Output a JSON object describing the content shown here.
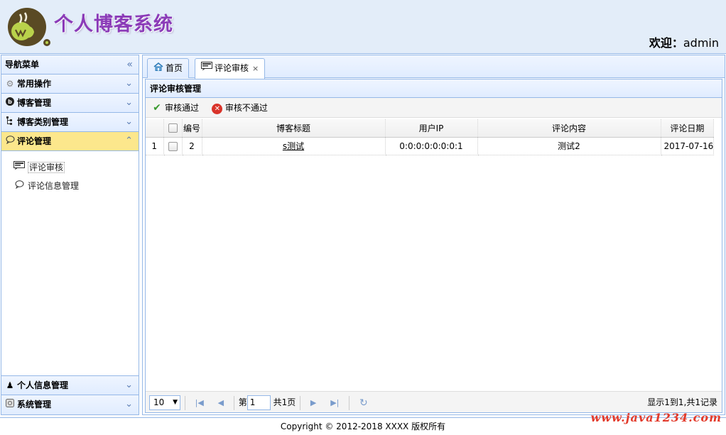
{
  "header": {
    "site_title": "个人博客系统",
    "welcome_label": "欢迎：",
    "username": "admin"
  },
  "sidebar": {
    "title": "导航菜单",
    "sections": [
      {
        "label": "常用操作",
        "icon": "gear-icon"
      },
      {
        "label": "博客管理",
        "icon": "blog-icon"
      },
      {
        "label": "博客类别管理",
        "icon": "tree-icon"
      },
      {
        "label": "评论管理",
        "icon": "comment-icon"
      },
      {
        "label": "个人信息管理",
        "icon": "user-icon"
      },
      {
        "label": "系统管理",
        "icon": "system-icon"
      }
    ],
    "subitems": [
      {
        "label": "评论审核",
        "icon": "review-icon"
      },
      {
        "label": "评论信息管理",
        "icon": "comment-icon"
      }
    ]
  },
  "tabs": [
    {
      "label": "首页",
      "icon": "home-icon"
    },
    {
      "label": "评论审核",
      "icon": "review-icon"
    }
  ],
  "panel": {
    "title": "评论审核管理",
    "toolbar": {
      "approve_label": "审核通过",
      "reject_label": "审核不通过"
    }
  },
  "table": {
    "columns": [
      "编号",
      "博客标题",
      "用户IP",
      "评论内容",
      "评论日期"
    ],
    "rows": [
      {
        "rownum": "1",
        "id": "2",
        "blog_title": "s测试",
        "user_ip": "0:0:0:0:0:0:0:1",
        "content": "测试2",
        "date": "2017-07-16"
      }
    ]
  },
  "pager": {
    "page_size": "10",
    "page_prefix": "第",
    "page_value": "1",
    "page_total": "共1页",
    "info": "显示1到1,共1记录"
  },
  "footer": {
    "copyright": "Copyright © 2012-2018 XXXX 版权所有",
    "watermark": "www.java1234.com"
  },
  "colors": {
    "header_bg": "#E3EDF9",
    "title_purple": "#8B3BB8",
    "border_blue": "#95B8E7",
    "active_section": "#FCE78C"
  }
}
